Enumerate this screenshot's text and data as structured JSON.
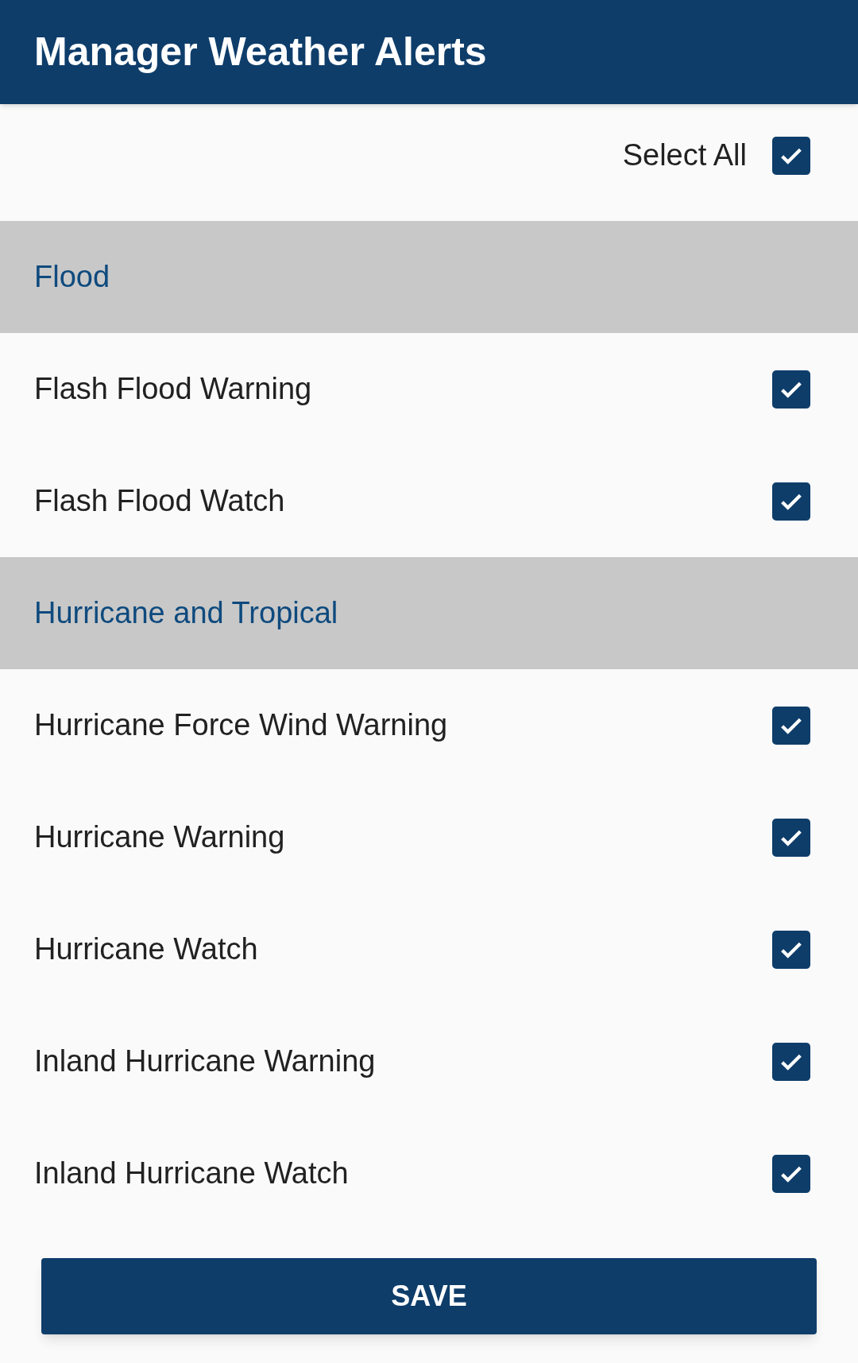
{
  "app_bar": {
    "title": "Manager Weather Alerts"
  },
  "select_all": {
    "label": "Select All",
    "checked": true
  },
  "sections": [
    {
      "title": "Flood",
      "items": [
        {
          "label": "Flash Flood Warning",
          "checked": true
        },
        {
          "label": "Flash Flood Watch",
          "checked": true
        }
      ]
    },
    {
      "title": "Hurricane and Tropical",
      "items": [
        {
          "label": "Hurricane Force Wind Warning",
          "checked": true
        },
        {
          "label": "Hurricane Warning",
          "checked": true
        },
        {
          "label": "Hurricane Watch",
          "checked": true
        },
        {
          "label": "Inland Hurricane Warning",
          "checked": true
        },
        {
          "label": "Inland Hurricane Watch",
          "checked": true
        }
      ]
    }
  ],
  "save_button": {
    "label": "SAVE"
  }
}
